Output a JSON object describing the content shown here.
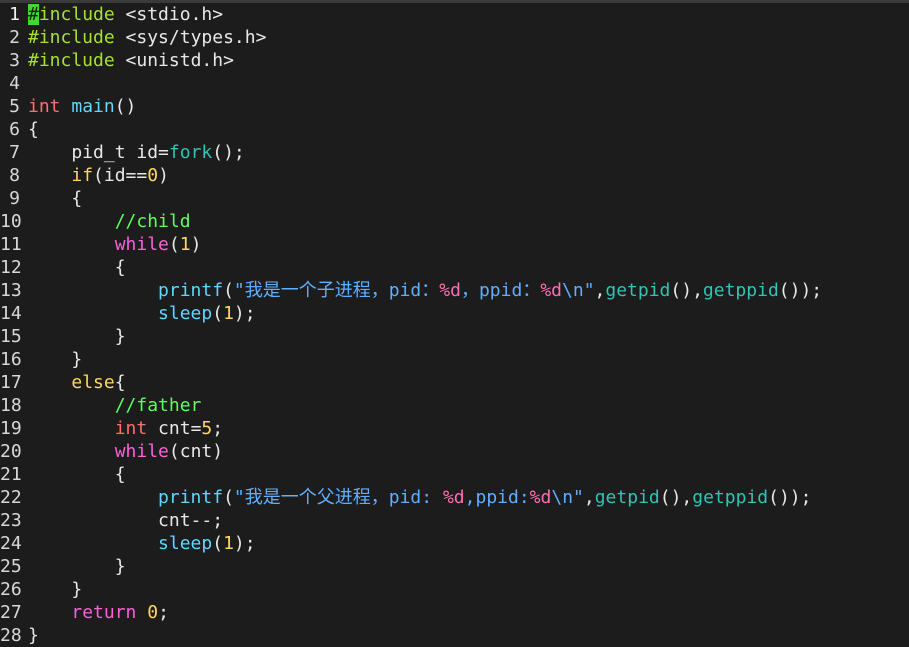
{
  "editor": {
    "current_line": 1,
    "lines": [
      {
        "n": "1",
        "segs": [
          [
            "cursor",
            "#"
          ],
          [
            "t-pre",
            "include"
          ],
          [
            "t-id",
            " "
          ],
          [
            "t-hdr",
            "<stdio.h>"
          ]
        ]
      },
      {
        "n": "2",
        "segs": [
          [
            "t-pre",
            "#include"
          ],
          [
            "t-id",
            " "
          ],
          [
            "t-hdr",
            "<sys/types.h>"
          ]
        ]
      },
      {
        "n": "3",
        "segs": [
          [
            "t-pre",
            "#include"
          ],
          [
            "t-id",
            " "
          ],
          [
            "t-hdr",
            "<unistd.h>"
          ]
        ]
      },
      {
        "n": "4",
        "segs": []
      },
      {
        "n": "5",
        "segs": [
          [
            "t-type",
            "int"
          ],
          [
            "t-id",
            " "
          ],
          [
            "t-func",
            "main"
          ],
          [
            "t-id",
            "()"
          ]
        ]
      },
      {
        "n": "6",
        "segs": [
          [
            "t-id",
            "{"
          ]
        ]
      },
      {
        "n": "7",
        "segs": [
          [
            "t-id",
            "    pid_t id="
          ],
          [
            "t-fn2",
            "fork"
          ],
          [
            "t-id",
            "();"
          ]
        ]
      },
      {
        "n": "8",
        "segs": [
          [
            "t-id",
            "    "
          ],
          [
            "t-kw",
            "if"
          ],
          [
            "t-id",
            "(id=="
          ],
          [
            "t-num",
            "0"
          ],
          [
            "t-id",
            ")"
          ]
        ]
      },
      {
        "n": "9",
        "segs": [
          [
            "t-id",
            "    {"
          ]
        ]
      },
      {
        "n": "10",
        "segs": [
          [
            "t-id",
            "        "
          ],
          [
            "t-com",
            "//child"
          ]
        ]
      },
      {
        "n": "11",
        "segs": [
          [
            "t-id",
            "        "
          ],
          [
            "t-ctl",
            "while"
          ],
          [
            "t-id",
            "("
          ],
          [
            "t-num",
            "1"
          ],
          [
            "t-id",
            ")"
          ]
        ]
      },
      {
        "n": "12",
        "segs": [
          [
            "t-id",
            "        {"
          ]
        ]
      },
      {
        "n": "13",
        "segs": [
          [
            "t-id",
            "            "
          ],
          [
            "t-func",
            "printf"
          ],
          [
            "t-id",
            "("
          ],
          [
            "t-str",
            "\"我是一个子进程，pid："
          ],
          [
            "t-fmt",
            "%d"
          ],
          [
            "t-str",
            "，ppid："
          ],
          [
            "t-fmt",
            "%d"
          ],
          [
            "t-str",
            "\\n\""
          ],
          [
            "t-id",
            ","
          ],
          [
            "t-fn2",
            "getpid"
          ],
          [
            "t-id",
            "(),"
          ],
          [
            "t-fn2",
            "getppid"
          ],
          [
            "t-id",
            "());"
          ]
        ]
      },
      {
        "n": "14",
        "segs": [
          [
            "t-id",
            "            "
          ],
          [
            "t-func",
            "sleep"
          ],
          [
            "t-id",
            "("
          ],
          [
            "t-num",
            "1"
          ],
          [
            "t-id",
            ");"
          ]
        ]
      },
      {
        "n": "15",
        "segs": [
          [
            "t-id",
            "        }"
          ]
        ]
      },
      {
        "n": "16",
        "segs": [
          [
            "t-id",
            "    }"
          ]
        ]
      },
      {
        "n": "17",
        "segs": [
          [
            "t-id",
            "    "
          ],
          [
            "t-kw",
            "else"
          ],
          [
            "t-id",
            "{"
          ]
        ]
      },
      {
        "n": "18",
        "segs": [
          [
            "t-id",
            "        "
          ],
          [
            "t-com",
            "//father"
          ]
        ]
      },
      {
        "n": "19",
        "segs": [
          [
            "t-id",
            "        "
          ],
          [
            "t-type",
            "int"
          ],
          [
            "t-id",
            " cnt="
          ],
          [
            "t-num",
            "5"
          ],
          [
            "t-id",
            ";"
          ]
        ]
      },
      {
        "n": "20",
        "segs": [
          [
            "t-id",
            "        "
          ],
          [
            "t-ctl",
            "while"
          ],
          [
            "t-id",
            "(cnt)"
          ]
        ]
      },
      {
        "n": "21",
        "segs": [
          [
            "t-id",
            "        {"
          ]
        ]
      },
      {
        "n": "22",
        "segs": [
          [
            "t-id",
            "            "
          ],
          [
            "t-func",
            "printf"
          ],
          [
            "t-id",
            "("
          ],
          [
            "t-str",
            "\"我是一个父进程，pid: "
          ],
          [
            "t-fmt",
            "%d"
          ],
          [
            "t-str",
            ",ppid:"
          ],
          [
            "t-fmt",
            "%d"
          ],
          [
            "t-str",
            "\\n\""
          ],
          [
            "t-id",
            ","
          ],
          [
            "t-fn2",
            "getpid"
          ],
          [
            "t-id",
            "(),"
          ],
          [
            "t-fn2",
            "getppid"
          ],
          [
            "t-id",
            "());"
          ]
        ]
      },
      {
        "n": "23",
        "segs": [
          [
            "t-id",
            "            cnt--;"
          ]
        ]
      },
      {
        "n": "24",
        "segs": [
          [
            "t-id",
            "            "
          ],
          [
            "t-func",
            "sleep"
          ],
          [
            "t-id",
            "("
          ],
          [
            "t-num",
            "1"
          ],
          [
            "t-id",
            ");"
          ]
        ]
      },
      {
        "n": "25",
        "segs": [
          [
            "t-id",
            "        }"
          ]
        ]
      },
      {
        "n": "26",
        "segs": [
          [
            "t-id",
            "    }"
          ]
        ]
      },
      {
        "n": "27",
        "segs": [
          [
            "t-id",
            "    "
          ],
          [
            "t-ctl",
            "return"
          ],
          [
            "t-id",
            " "
          ],
          [
            "t-num",
            "0"
          ],
          [
            "t-id",
            ";"
          ]
        ]
      },
      {
        "n": "28",
        "segs": [
          [
            "t-id",
            "}"
          ]
        ]
      }
    ]
  }
}
